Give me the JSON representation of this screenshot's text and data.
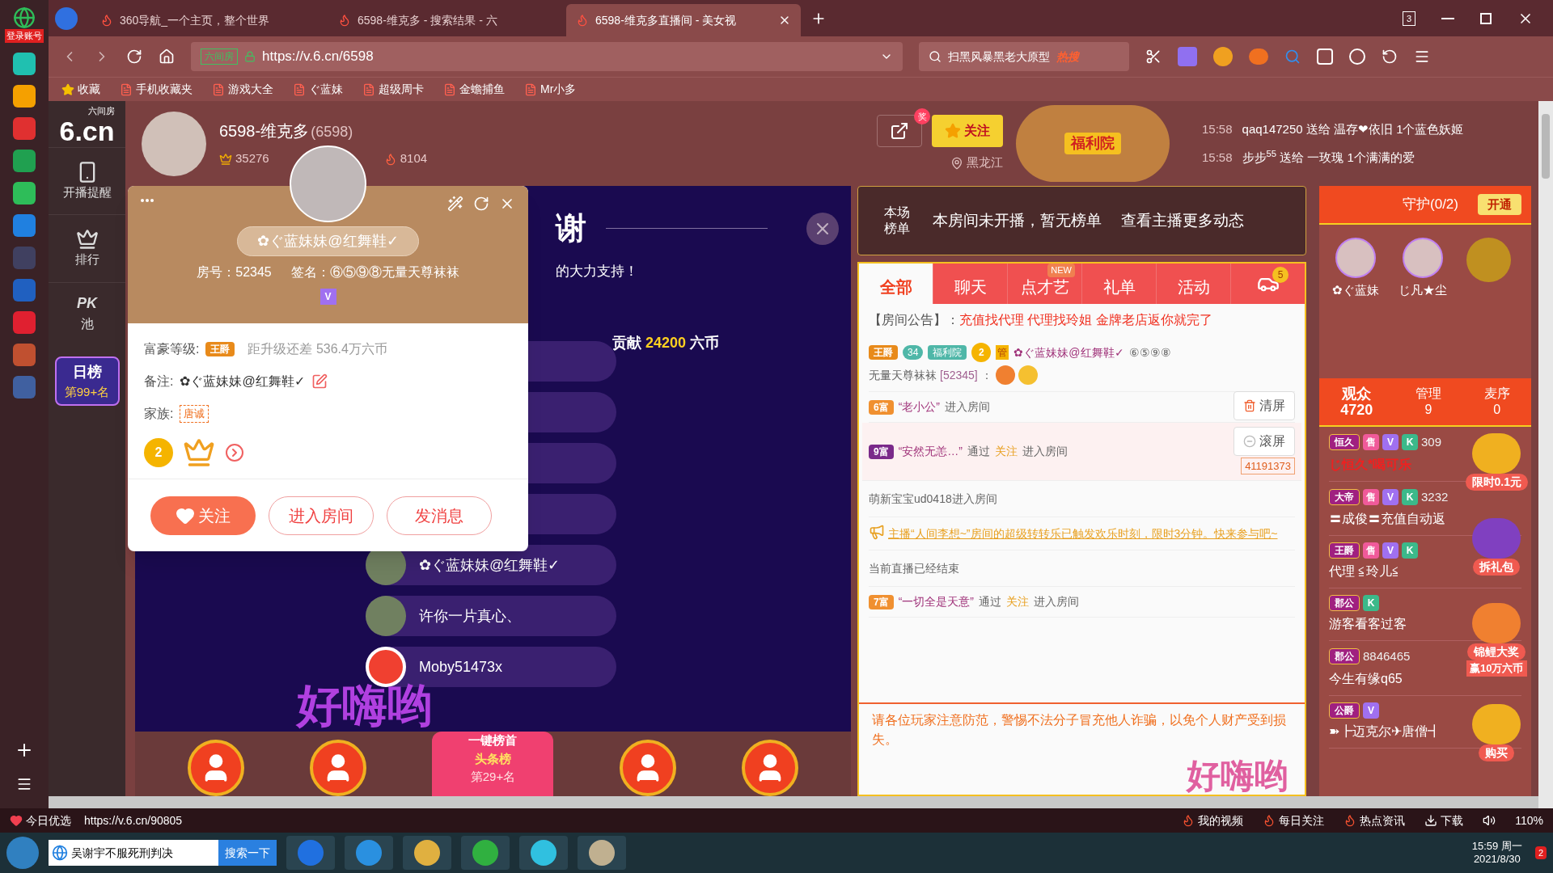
{
  "browser": {
    "login_label": "登录账号",
    "tabs": [
      {
        "label": "360导航_一个主页，整个世界",
        "selected": false
      },
      {
        "label": "6598-维克多 - 搜索结果 - 六",
        "selected": false
      },
      {
        "label": "6598-维克多直播间 - 美女视",
        "selected": true
      }
    ],
    "tab_count": "3",
    "address_badge": "六间房",
    "address": "https://v.6.cn/6598",
    "search": {
      "value": "扫黑风暴黑老大原型",
      "badge": "热搜"
    },
    "bookmarks": [
      "收藏",
      "手机收藏夹",
      "游戏大全",
      "ぐ蓝妹",
      "超级周卡",
      "金蟾捕鱼",
      "Mr小多"
    ]
  },
  "site_nav": {
    "logo_small": "六间房",
    "logo": "6.cn",
    "items": [
      "开播提醒",
      "排行"
    ],
    "pk_top": "PK",
    "pk_bottom": "池",
    "daily_title": "日榜",
    "daily_rank": "第99+名"
  },
  "host": {
    "name": "6598-维克多",
    "id": "(6598)",
    "coins": "35276",
    "fire": "8104",
    "reward_badge": "奖",
    "follow": "关注",
    "location": "黑龙江",
    "banner": "福利院"
  },
  "gift_feed": [
    {
      "time": "15:58",
      "text": "qaq147250 送给 温存❤依旧 1个蓝色妖姬"
    },
    {
      "time": "15:58",
      "text": "步步$^{55}$ 送给 一玫瑰 1个满满的爱"
    }
  ],
  "thanks": {
    "title": "谢",
    "subtitle": "的大力支持！",
    "contribution_label": "贡献",
    "contribution_amount": "24200",
    "contribution_unit": "六币",
    "viewers": [
      {
        "name": "✿ぐ蓝妹妹@红舞鞋✓"
      },
      {
        "name": "许你一片真心、"
      },
      {
        "name": "Moby51473x"
      }
    ],
    "rank_button": "一键榜首",
    "rank_title": "头条榜",
    "rank_place": "第29+名"
  },
  "profile_card": {
    "name": "✿ぐ蓝妹妹@红舞鞋✓",
    "room": "房号：52345",
    "signature": "签名：⑥⑤⑨⑧无量天尊袜袜",
    "vip": "V",
    "wealth_label": "富豪等级:",
    "wealth_badge": "王爵",
    "upgrade": "距升级还差 536.4万六币",
    "note_label": "备注:",
    "note": "✿ぐ蓝妹妹@红舞鞋✓",
    "family_label": "家族:",
    "family": "唐诚",
    "medal": "2",
    "buttons": [
      "关注",
      "进入房间",
      "发消息"
    ]
  },
  "leaderboard": {
    "label": "本场榜单",
    "text": "本房间未开播，暂无榜单",
    "link": "查看主播更多动态"
  },
  "chat_tabs": [
    {
      "label": "全部",
      "selected": true
    },
    {
      "label": "聊天",
      "selected": false
    },
    {
      "label": "点才艺",
      "selected": false,
      "badge": "NEW"
    },
    {
      "label": "礼单",
      "selected": false
    },
    {
      "label": "活动",
      "selected": false
    }
  ],
  "car_count": "5",
  "announcement": {
    "label": "【房间公告】：",
    "text": "充值找代理 代理找玲姐 金牌老店返你就完了"
  },
  "messages": [
    {
      "kind": "chat",
      "badge": "王爵",
      "level": "34",
      "group": "福利院",
      "medal": "2",
      "admin": "管",
      "name": "✿ぐ蓝妹妹@红舞鞋✓",
      "tag": "⑥⑤⑨⑧",
      "sender": "无量天尊袜袜",
      "room": "[52345]",
      "colon": "："
    },
    {
      "kind": "enter",
      "badge": "6富",
      "name": "“老小公”",
      "text": "进入房间"
    },
    {
      "kind": "follow",
      "badge": "9富",
      "name": "“安然无恙…”",
      "pre": "通过",
      "link": "关注",
      "text": "进入房间",
      "car_id": "41191373"
    },
    {
      "kind": "plain",
      "text": "萌新宝宝ud0418进入房间"
    },
    {
      "kind": "notice",
      "text": "主播“人间李想~”房间的超级转转乐已触发欢乐时刻，限时3分钟。快来参与吧~"
    },
    {
      "kind": "plain",
      "text": "当前直播已经结束"
    },
    {
      "kind": "follow",
      "badge": "7富",
      "name": "“一切全是天意”",
      "pre": "通过",
      "link": "关注",
      "text": "进入房间"
    }
  ],
  "chat_buttons": [
    "清屏",
    "滚屏"
  ],
  "warning": "请各位玩家注意防范，警惕不法分子冒充他人诈骗，以免个人财产受到损失。",
  "guard": {
    "title": "守护(0/2)",
    "button": "开通",
    "members": [
      {
        "name": "✿ぐ蓝妹"
      },
      {
        "name": "じ凡★尘"
      }
    ]
  },
  "stats": [
    {
      "label": "观众",
      "value": "4720",
      "selected": true
    },
    {
      "label": "管理",
      "value": "9",
      "selected": false
    },
    {
      "label": "麦序",
      "value": "0",
      "selected": false
    }
  ],
  "audience": [
    {
      "title": "恒久",
      "tags": [
        "售",
        "V",
        "K"
      ],
      "number": "309",
      "name": "じ恒久*喝可乐"
    },
    {
      "title": "大帝",
      "tags": [
        "售",
        "V",
        "K"
      ],
      "number": "3232",
      "name": "〓成俊〓充值自动返"
    },
    {
      "title": "王爵",
      "tags": [
        "售",
        "V",
        "K"
      ],
      "name": "代理 ≦玲儿≦"
    },
    {
      "title": "郡公",
      "tags": [
        "K"
      ],
      "name": "游客看客过客"
    },
    {
      "title": "郡公",
      "number": "8846465",
      "name": "今生有缘q65"
    },
    {
      "title": "公爵",
      "tags": [
        "V"
      ],
      "name": "➽┣迈克尔✈唐僧┫"
    }
  ],
  "promos": [
    "限时0.1元",
    "拆礼包",
    "锦鲤大奖",
    "赢10万六币",
    "购买"
  ],
  "overlays": [
    "好嗨哟",
    "好嗨哟"
  ],
  "status_bar": {
    "left": "今日优选",
    "url": "https://v.6.cn/90805",
    "items": [
      "我的视频",
      "每日关注",
      "热点资讯",
      "下载"
    ],
    "zoom": "110%"
  },
  "taskbar": {
    "search": "吴谢宇不服死刑判决",
    "search_button": "搜索一下",
    "time": "15:59 周一",
    "date": "2021/8/30",
    "notifications": "2"
  }
}
